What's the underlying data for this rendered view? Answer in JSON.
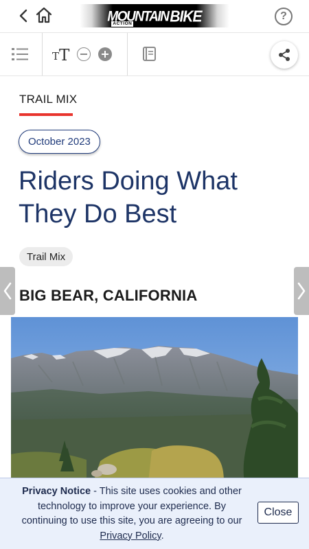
{
  "header": {
    "back_icon": "chevron-left-icon",
    "home_icon": "home-icon",
    "logo_text_main": "MOUNTAIN",
    "logo_text_bike": "BIKE",
    "logo_text_action": "ACTION",
    "help_label": "?"
  },
  "toolbar": {
    "toc_icon": "list-icon",
    "text_size_small": "T",
    "text_size_big": "T",
    "zoom_out_icon": "minus-circle-icon",
    "zoom_in_icon": "plus-circle-icon",
    "book_icon": "book-icon",
    "share_icon": "share-icon"
  },
  "article": {
    "section": "TRAIL MIX",
    "date": "October 2023",
    "title": "Riders Doing What They Do Best",
    "tag": "Trail Mix",
    "location": "BIG BEAR, CALIFORNIA"
  },
  "privacy": {
    "heading": "Privacy Notice",
    "body": " - This site uses cookies and other technology to improve your experience. By continuing to use this site, you are agreeing to our ",
    "link": "Privacy Policy",
    "end": ".",
    "close_label": "Close"
  },
  "colors": {
    "accent_red": "#e8342e",
    "title_blue": "#1d3466",
    "date_blue": "#1f3a7a",
    "banner_bg": "#eaf0fb"
  }
}
